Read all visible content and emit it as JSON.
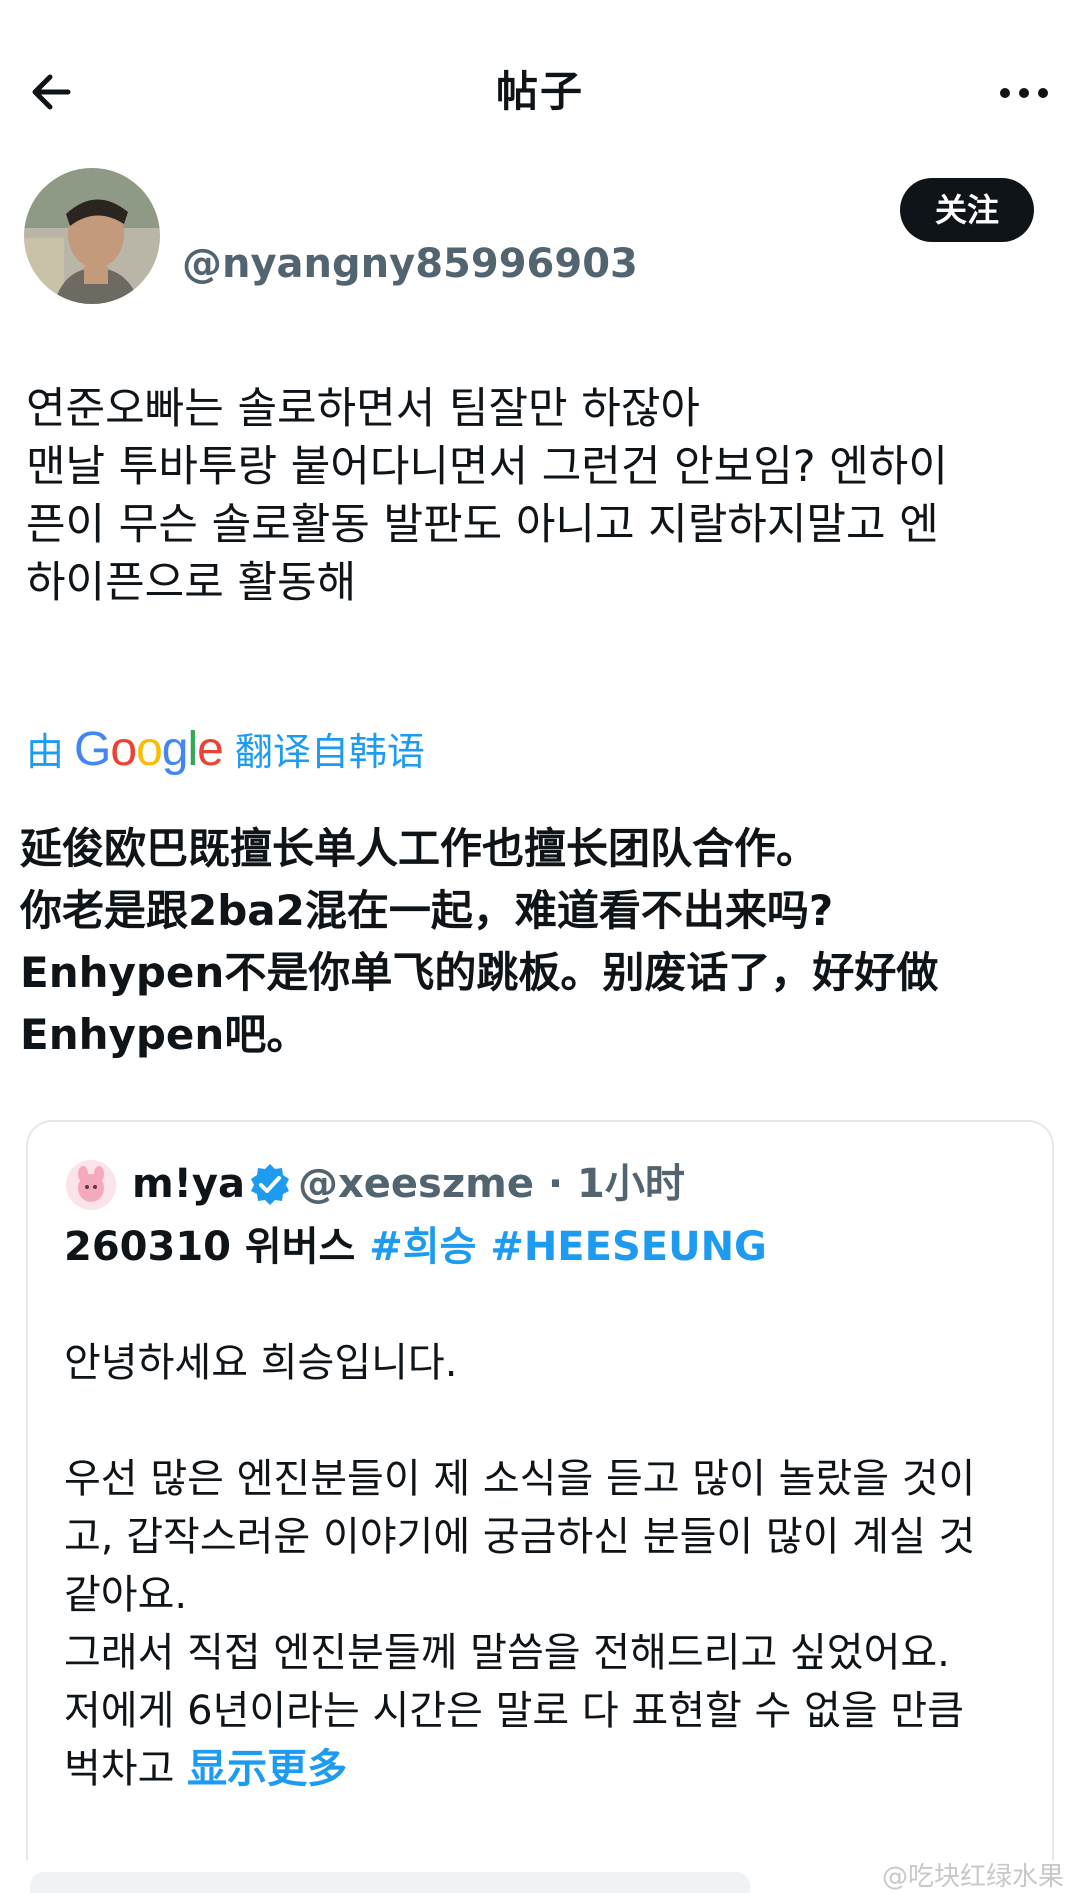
{
  "header": {
    "title": "帖子",
    "back_icon": "arrow-left-icon",
    "more_icon": "more-horizontal-icon"
  },
  "author": {
    "handle": "@nyangny85996903",
    "follow_label": "关注"
  },
  "post": {
    "lines": [
      "연준오빠는 솔로하면서 팀잘만 하잖아",
      "맨날 투바투랑 붙어다니면서 그런건 안보임? 엔하이",
      "픈이 무슨 솔로활동 발판도 아니고 지랄하지말고 엔",
      "하이픈으로 활동해"
    ]
  },
  "translation": {
    "prefix": "由",
    "brand": "Google",
    "suffix": "翻译自韩语",
    "lines": [
      "延俊欧巴既擅长单人工作也擅长团队合作。",
      "你老是跟2ba2混在一起，难道看不出来吗?",
      "Enhypen不是你单飞的跳板。别废话了，好好做",
      "Enhypen吧。"
    ]
  },
  "quote": {
    "name": "m!ya",
    "handle_time": "@xeeszme · 1小时",
    "headline_prefix": "260310 위버스 ",
    "hashtag_1": "#희승",
    "hashtag_2": "#HEESEUNG",
    "lines": [
      "안녕하세요 희승입니다.",
      "",
      "우선 많은 엔진분들이 제 소식을 듣고 많이 놀랐을 것이",
      "고, 갑작스러운 이야기에 궁금하신 분들이 많이 계실 것",
      "같아요.",
      "그래서 직접 엔진분들께 말씀을 전해드리고 싶었어요.",
      "저에게 6년이라는 시간은 말로 다 표현할 수 없을 만큼"
    ],
    "last_line_prefix": "벅차고 ",
    "show_more": "显示更多"
  },
  "watermark": "@吃块红绿水果",
  "colors": {
    "accent": "#1d9bf0",
    "text": "#0f1419",
    "secondary": "#536471",
    "border": "#e1e8ed"
  }
}
